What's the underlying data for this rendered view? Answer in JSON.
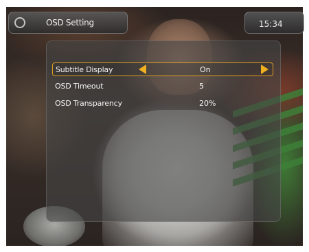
{
  "header": {
    "title": "OSD Setting",
    "time": "15:34"
  },
  "menu": {
    "items": [
      {
        "label": "Subtitle Display",
        "value": "On"
      },
      {
        "label": "OSD Timeout",
        "value": "5"
      },
      {
        "label": "OSD Transparency",
        "value": "20%"
      }
    ]
  },
  "icons": {
    "logo": "globe-logo-icon",
    "left": "arrow-left-icon",
    "right": "arrow-right-icon"
  },
  "colors": {
    "accent": "#f0b020",
    "panel": "#464646"
  }
}
